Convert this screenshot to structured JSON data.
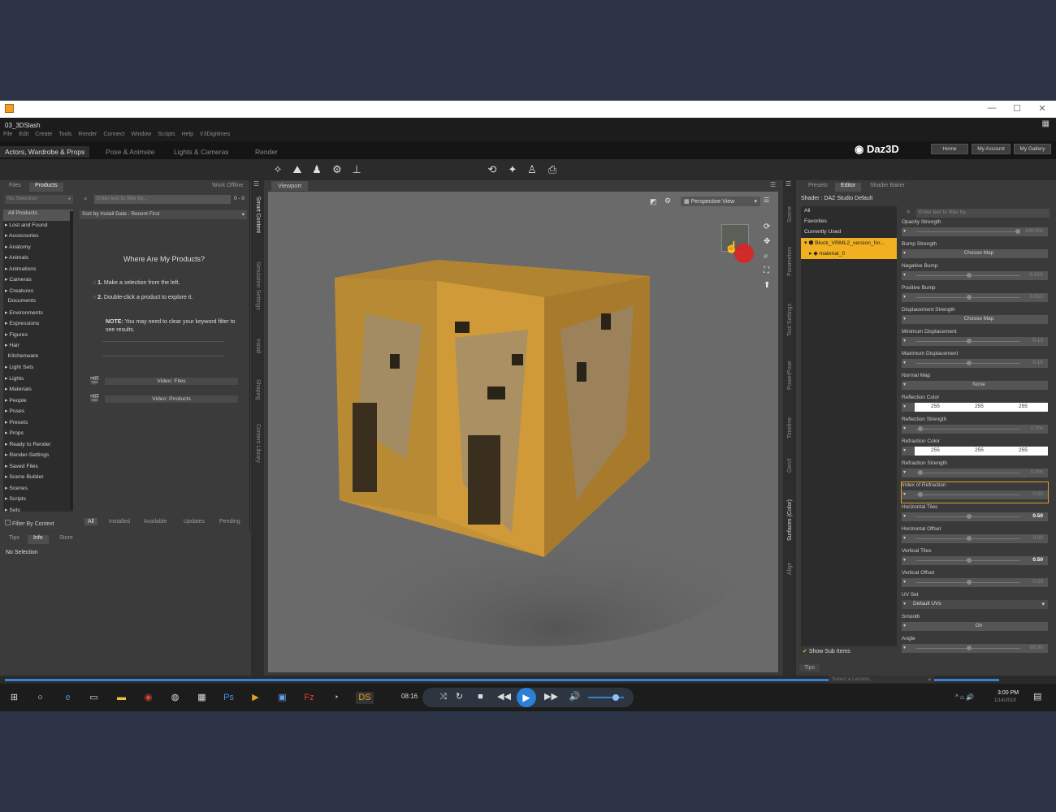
{
  "window": {
    "title": "03_3DSlash",
    "min": "—",
    "max": "☐",
    "close": "✕"
  },
  "menu": [
    "File",
    "Edit",
    "Create",
    "Tools",
    "Render",
    "Connect",
    "Window",
    "Scripts",
    "Help",
    "V3Digitimes"
  ],
  "room_tabs": [
    "Actors, Wardrobe & Props",
    "Pose & Animate",
    "Lights & Cameras",
    "Render"
  ],
  "brand": {
    "logo": "Daz3D",
    "home": "Home",
    "account": "My Account",
    "gallery": "My Gallery"
  },
  "left_tabs": {
    "files": "Files",
    "products": "Products",
    "work_offline": "Work Offline"
  },
  "left": {
    "selection": "No Selection",
    "filter_placeholder": "Enter text to filter by...",
    "count": "0 - 0",
    "sort": "Sort by Install Date : Recent First",
    "categories": [
      "All Products",
      "Lost and Found",
      "Accessories",
      "Anatomy",
      "Animals",
      "Animations",
      "Cameras",
      "Creatures",
      "Documents",
      "Environments",
      "Expressions",
      "Figures",
      "Hair",
      "Kitchenware",
      "Light Sets",
      "Lights",
      "Materials",
      "People",
      "Poses",
      "Presets",
      "Props",
      "Ready to Render",
      "Render-Settings",
      "Saved Files",
      "Scene Builder",
      "Scenes",
      "Scripts",
      "Sets"
    ],
    "where_title": "Where Are My Products?",
    "step1_num": "1.",
    "step1": "Make a selection from the left.",
    "step2_num": "2.",
    "step2": "Double-click a product to explore it.",
    "note_label": "NOTE:",
    "note": "You may need to clear your keyword filter to see results.",
    "video_files": "Video: Files",
    "video_products": "Video: Products",
    "filter_by_context": "Filter By Context",
    "bottom_tabs": [
      "All",
      "Installed",
      "Available",
      "Updates",
      "Pending"
    ],
    "info_tabs": [
      "Tips",
      "Info",
      "Store"
    ],
    "info_text": "No Selection"
  },
  "left_vtabs": [
    "Smart Content",
    "Simulation Settings",
    "Install",
    "Shaping",
    "Content Library"
  ],
  "viewport": {
    "tab": "Viewport",
    "view": "Perspective View"
  },
  "right_vtabs": [
    "Scene",
    "Parameters",
    "Tool Settings",
    "PowerPose",
    "Timeline",
    "GenX",
    "Surfaces (Color)",
    "Align"
  ],
  "right": {
    "tabs": [
      "Presets",
      "Editor",
      "Shader Baker"
    ],
    "shader": "Shader : DAZ Studio Default",
    "filter_placeholder": "Enter text to filter by...",
    "nodes": [
      "All",
      "Favorites",
      "Currently Used"
    ],
    "object": "Block_VRML2_version_for...",
    "material": "material_0",
    "show_sub_items": "Show Sub Items",
    "tips_tab": "Tips"
  },
  "properties": [
    {
      "label": "Opacity Strength",
      "value": "100.0%",
      "type": "slider",
      "pos": 0.98
    },
    {
      "label": "Bump Strength",
      "value": "Choose Map",
      "type": "map"
    },
    {
      "label": "Negative Bump",
      "value": "-0.010",
      "type": "slider",
      "pos": 0.5
    },
    {
      "label": "Positive Bump",
      "value": "0.010",
      "type": "slider",
      "pos": 0.5
    },
    {
      "label": "Displacement Strength",
      "value": "Choose Map",
      "type": "map"
    },
    {
      "label": "Minimum Displacement",
      "value": "-0.10",
      "type": "slider",
      "pos": 0.5
    },
    {
      "label": "Maximum Displacement",
      "value": "0.10",
      "type": "slider",
      "pos": 0.5
    },
    {
      "label": "Normal Map",
      "value": "None",
      "type": "map"
    },
    {
      "label": "Reflection Color",
      "values": [
        "255",
        "255",
        "255"
      ],
      "type": "color"
    },
    {
      "label": "Reflection Strength",
      "value": "0.0%",
      "type": "slider",
      "pos": 0.02
    },
    {
      "label": "Refraction Color",
      "values": [
        "255",
        "255",
        "255"
      ],
      "type": "color"
    },
    {
      "label": "Refraction Strength",
      "value": "0.0%",
      "type": "slider",
      "pos": 0.02
    },
    {
      "label": "Index of Refraction",
      "value": "0.00",
      "type": "slider",
      "pos": 0.02,
      "highlight": true
    },
    {
      "label": "Horizontal Tiles",
      "value": "0.50",
      "type": "slider",
      "pos": 0.5,
      "bold": true
    },
    {
      "label": "Horizontal Offset",
      "value": "0.00",
      "type": "slider",
      "pos": 0.5
    },
    {
      "label": "Vertical Tiles",
      "value": "0.50",
      "type": "slider",
      "pos": 0.5,
      "bold": true
    },
    {
      "label": "Vertical Offset",
      "value": "0.00",
      "type": "slider",
      "pos": 0.5
    },
    {
      "label": "UV Set",
      "value": "Default UVs",
      "type": "dropdown"
    },
    {
      "label": "Smooth",
      "value": "On",
      "type": "toggle"
    },
    {
      "label": "Angle",
      "value": "89.90",
      "type": "slider",
      "pos": 0.5
    }
  ],
  "lesson": "Select a Lesson...",
  "player": {
    "time": "08:16"
  },
  "clock": {
    "time": "3:00 PM",
    "date": "1/14/2019"
  },
  "colors": {
    "accent": "#f0b020",
    "highlight_row": "#f0b020",
    "desktop": "#2c3445"
  }
}
